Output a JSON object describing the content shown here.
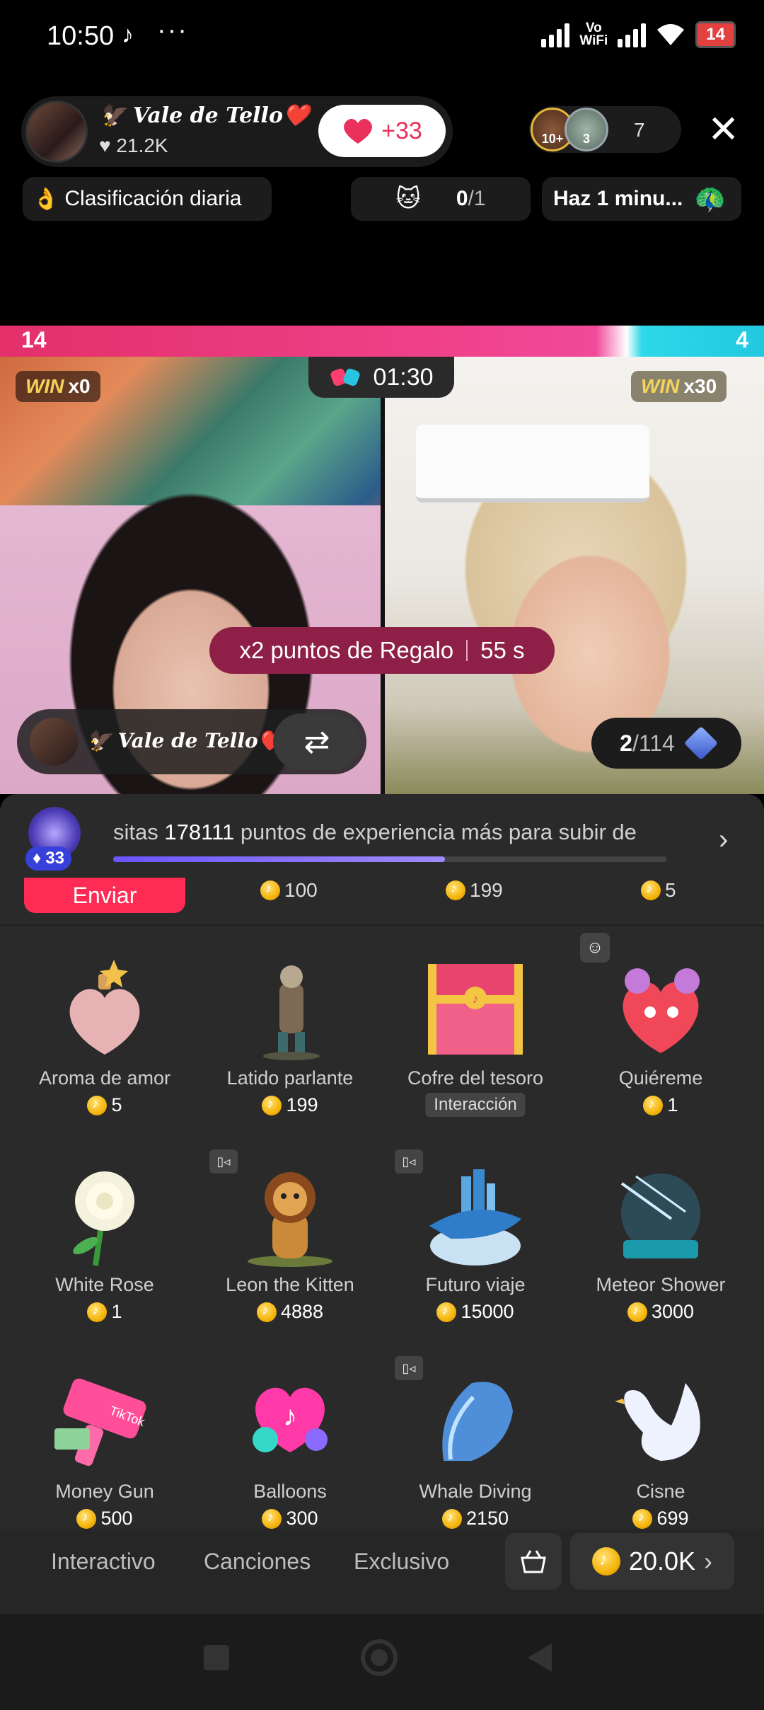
{
  "status": {
    "time": "10:50",
    "battery": "14",
    "wifi_label_top": "Vo",
    "wifi_label_bottom": "WiFi"
  },
  "host": {
    "name": "🦅 Vale de Tello❤️",
    "likes": "21.2K",
    "follow_count": "+33"
  },
  "viewers": {
    "badge1": "10+",
    "badge2": "3",
    "count": "7"
  },
  "chips": {
    "rank_label": "Clasificación diaria",
    "goal_done": "0",
    "goal_total": "/1",
    "task_label": "Haz 1 minu..."
  },
  "battle": {
    "score_left": "14",
    "score_right": "4",
    "win_word": "WIN",
    "win_left": "x0",
    "win_right": "x30",
    "timer": "01:30",
    "bonus_text": "x2 puntos de Regalo",
    "bonus_time": "55 s",
    "opponent_name": "🦅 Vale de Tello❤️",
    "gift_progress_current": "2",
    "gift_progress_total": "/114"
  },
  "level": {
    "badge": "33",
    "text_pre": "sitas ",
    "points": "178111",
    "text_post": " puntos de experiencia más para subir de",
    "progress": 0.6
  },
  "prev_row": {
    "send_label": "Enviar",
    "prices": [
      "100",
      "199",
      "5"
    ]
  },
  "gifts": [
    {
      "name": "Aroma de amor",
      "price": "5",
      "tag": ""
    },
    {
      "name": "Latido parlante",
      "price": "199",
      "tag": ""
    },
    {
      "name": "Cofre del tesoro",
      "price": "",
      "tag": "Interacción"
    },
    {
      "name": "Quiéreme",
      "price": "1",
      "tag": ""
    },
    {
      "name": "White Rose",
      "price": "1",
      "tag": ""
    },
    {
      "name": "Leon the Kitten",
      "price": "4888",
      "tag": ""
    },
    {
      "name": "Futuro viaje",
      "price": "15000",
      "tag": ""
    },
    {
      "name": "Meteor Shower",
      "price": "3000",
      "tag": ""
    },
    {
      "name": "Money Gun",
      "price": "500",
      "tag": ""
    },
    {
      "name": "Balloons",
      "price": "300",
      "tag": ""
    },
    {
      "name": "Whale Diving",
      "price": "2150",
      "tag": ""
    },
    {
      "name": "Cisne",
      "price": "699",
      "tag": ""
    }
  ],
  "tabs": [
    "Interactivo",
    "Canciones",
    "Exclusivo"
  ],
  "wallet": {
    "coins": "20.0K"
  },
  "colors": {
    "accent": "#fe2c55",
    "battle_pink": "#f0428c",
    "battle_cyan": "#22c8e0",
    "coin": "#f5b50a"
  }
}
